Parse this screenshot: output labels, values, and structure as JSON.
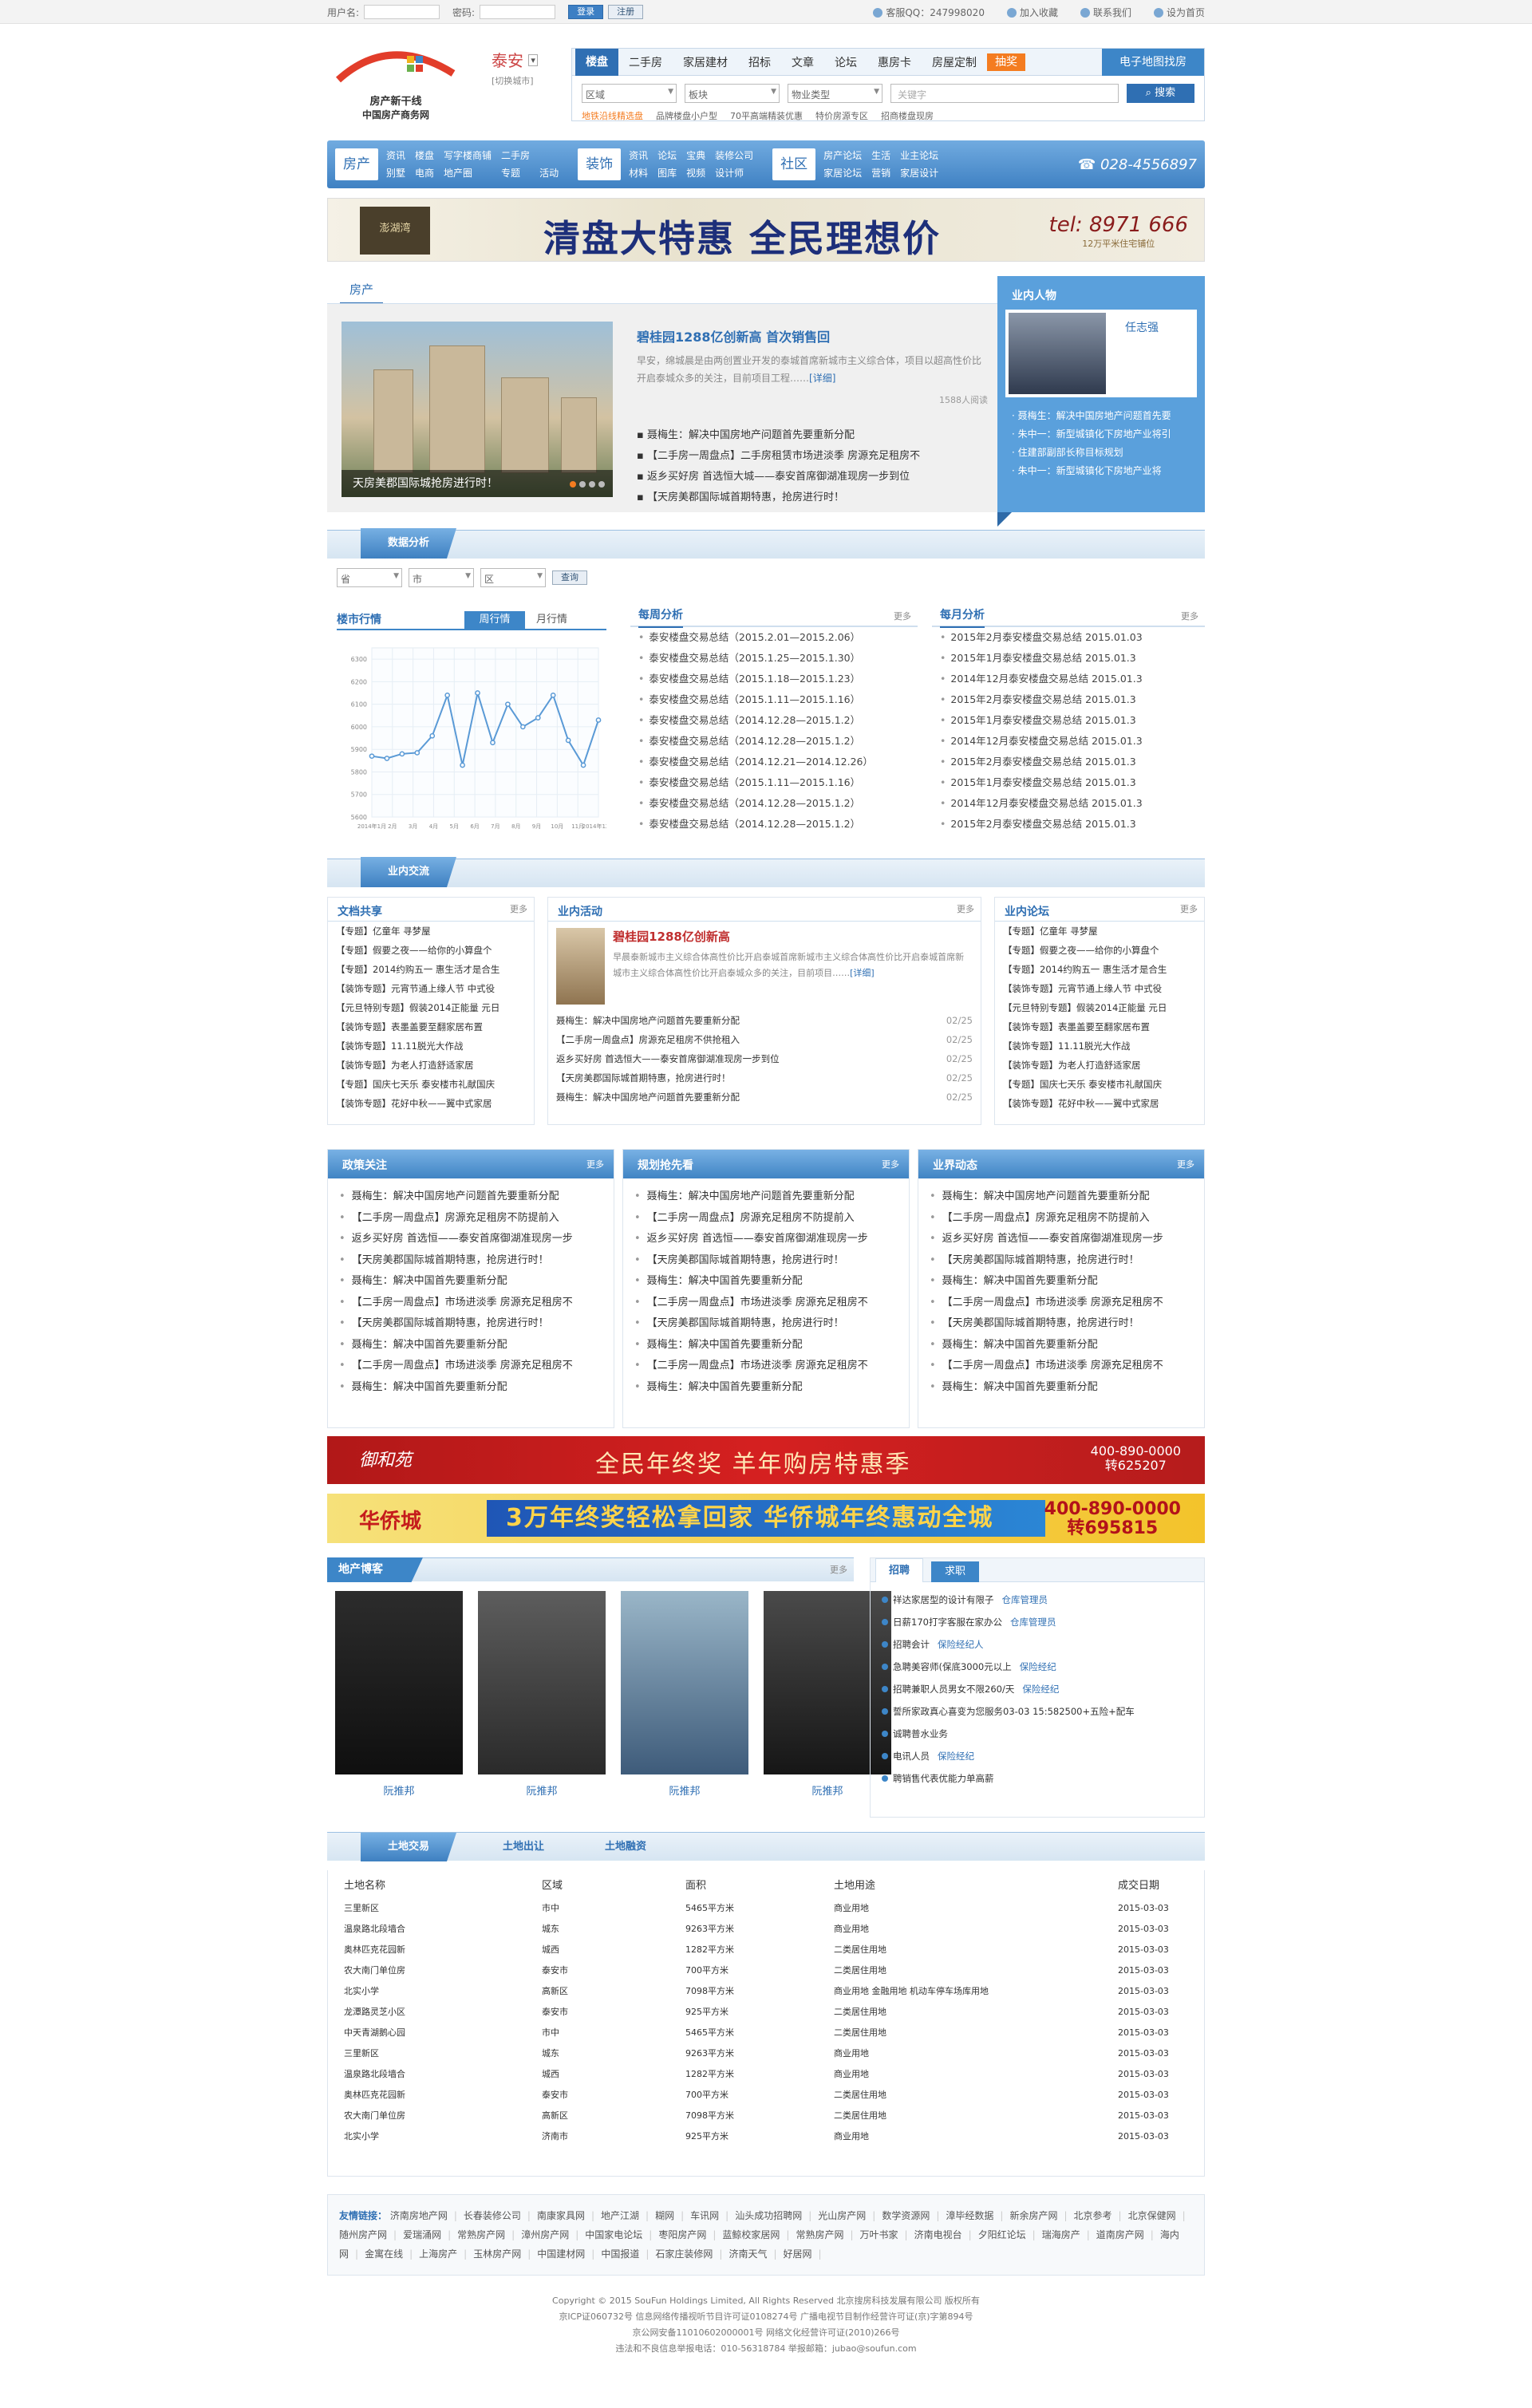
{
  "topbar": {
    "username_label": "用户名:",
    "password_label": "密码:",
    "login": "登录",
    "register": "注册",
    "qq": "客服QQ：247998020",
    "favorite": "加入收藏",
    "contact": "联系我们",
    "homepage": "设为首页"
  },
  "logo": {
    "line1": "房产新干线",
    "line2": "中国房产商务网"
  },
  "city": {
    "name": "泰安",
    "switch": "[切换城市]"
  },
  "nav": {
    "tabs": [
      "楼盘",
      "二手房",
      "家居建材",
      "招标",
      "文章",
      "论坛",
      "惠房卡",
      "房屋定制"
    ],
    "hot": "抽奖",
    "map": "电子地图找房",
    "filters": [
      "区域",
      "板块",
      "物业类型"
    ],
    "search_placeholder": "关键字",
    "search_button": "搜索",
    "hot_links": [
      "地铁沿线精选盘",
      "品牌楼盘小户型",
      "70平高端精装优惠",
      "特价房源专区",
      "招商楼盘现房"
    ]
  },
  "channels": [
    {
      "name": "房产",
      "links": [
        "资讯",
        "别墅",
        "楼盘",
        "电商",
        "写字楼商铺",
        "地产圈",
        "二手房",
        "专题",
        "",
        "活动"
      ]
    },
    {
      "name": "装饰",
      "links": [
        "资讯",
        "材料",
        "论坛",
        "图库",
        "宝典",
        "视频",
        "装修公司",
        "设计师"
      ]
    },
    {
      "name": "社区",
      "links": [
        "房产论坛",
        "家居论坛",
        "生活",
        "营销",
        "业主论坛",
        "家居设计"
      ]
    }
  ],
  "phone": "028-4556897",
  "banner1": {
    "logo": "澎湖湾",
    "text": "清盘大特惠  全民理想价",
    "tel": "tel: 8971 666",
    "sub": "12万平米住宅铺位"
  },
  "house": {
    "tab": "房产",
    "photo_caption": "天房美郡国际城抢房进行时！",
    "headline": "碧桂园1288亿创新高 首次销售回",
    "summary": "早安，绵城晨是由两创置业开发的泰城首席新城市主义综合体，项目以超高性价比开启泰城众多的关注，目前项目工程……",
    "detail": "[详细]",
    "reads": "1588人阅读",
    "news": [
      "聂梅生：解决中国房地产问题首先要重新分配",
      "【二手房一周盘点】二手房租赁市场进淡季 房源充足租房不",
      "返乡买好房 首选恒大城——泰安首席御湖准现房一步到位",
      "【天房美郡国际城首期特惠，抢房进行时！"
    ]
  },
  "person": {
    "title": "业内人物",
    "name": "任志强",
    "items": [
      "聂梅生：解决中国房地产问题首先要",
      "朱中一：新型城镇化下房地产业将引",
      "住建部副部长称目标规划",
      "朱中一：新型城镇化下房地产业将"
    ]
  },
  "data_section": {
    "title": "数据分析",
    "filters": [
      "省",
      "市",
      "区"
    ],
    "query": "查询",
    "market_title": "楼市行情",
    "tab_week": "周行情",
    "tab_month": "月行情",
    "weekly_title": "每周分析",
    "monthly_title": "每月分析",
    "more": "更多",
    "weekly": [
      "泰安楼盘交易总结（2015.2.01—2015.2.06）",
      "泰安楼盘交易总结（2015.1.25—2015.1.30）",
      "泰安楼盘交易总结（2015.1.18—2015.1.23）",
      "泰安楼盘交易总结（2015.1.11—2015.1.16）",
      "泰安楼盘交易总结（2014.12.28—2015.1.2）",
      "泰安楼盘交易总结（2014.12.28—2015.1.2）",
      "泰安楼盘交易总结（2014.12.21—2014.12.26）",
      "泰安楼盘交易总结（2015.1.11—2015.1.16）",
      "泰安楼盘交易总结（2014.12.28—2015.1.2）",
      "泰安楼盘交易总结（2014.12.28—2015.1.2）"
    ],
    "monthly": [
      "2015年2月泰安楼盘交易总结   2015.01.03",
      "2015年1月泰安楼盘交易总结   2015.01.3",
      "2014年12月泰安楼盘交易总结   2015.01.3",
      "2015年2月泰安楼盘交易总结   2015.01.3",
      "2015年1月泰安楼盘交易总结   2015.01.3",
      "2014年12月泰安楼盘交易总结   2015.01.3",
      "2015年2月泰安楼盘交易总结   2015.01.3",
      "2015年1月泰安楼盘交易总结   2015.01.3",
      "2014年12月泰安楼盘交易总结   2015.01.3",
      "2015年2月泰安楼盘交易总结   2015.01.3"
    ]
  },
  "chart_data": {
    "type": "line",
    "title": "楼市行情",
    "y_ticks": [
      "6300",
      "6200",
      "6100",
      "6000",
      "5900",
      "5800",
      "5700",
      "5600"
    ],
    "x_ticks": [
      "2014年1月",
      "2月",
      "3月",
      "4月",
      "5月",
      "6月",
      "7月",
      "8月",
      "9月",
      "10月",
      "11月",
      "2014年12月"
    ],
    "values": [
      5870,
      5860,
      5880,
      5885,
      5960,
      6140,
      5830,
      6150,
      5930,
      6100,
      6000,
      6040,
      6140,
      5940,
      5830,
      6030
    ],
    "ylim": [
      5600,
      6350
    ],
    "grid": true
  },
  "exchange": {
    "title": "业内交流",
    "docs_title": "文档共享",
    "activity_title": "业内活动",
    "forum_title": "业内论坛",
    "more": "更多",
    "docs": [
      "【专题】亿童年 寻梦屋",
      "【专题】假要之夜——给你的小算盘个",
      "【专题】2014约购五一 惠生活才是合生",
      "【装饰专题】元宵节通上缘人节 中式役",
      "【元旦特别专题】假装2014正能量  元日",
      "【装饰专题】表墨盖要至翻家居布置",
      "【装饰专题】11.11脱光大作战",
      "【装饰专题】为老人打造舒适家居",
      "【专题】国庆七天乐 泰安楼市礼献国庆",
      "【装饰专题】花好中秋——翼中式家居"
    ],
    "activity": {
      "headline": "碧桂园1288亿创新高",
      "summary": "早晨泰新城市主义综合体高性价比开启泰城首席新城市主义综合体高性价比开启泰城首席新城市主义综合体高性价比开启泰城众多的关注，目前项目……",
      "detail": "[详细]",
      "items": [
        {
          "t": "聂梅生：解决中国房地产问题首先要重新分配",
          "d": "02/25"
        },
        {
          "t": "【二手房一周盘点】房源充足租房不供抢租入",
          "d": "02/25"
        },
        {
          "t": "返乡买好房 首选恒大——泰安首席御湖准现房一步到位",
          "d": "02/25"
        },
        {
          "t": "【天房美郡国际城首期特惠，抢房进行时！",
          "d": "02/25"
        },
        {
          "t": "聂梅生：解决中国房地产问题首先要重新分配",
          "d": "02/25"
        }
      ]
    },
    "forum": [
      "【专题】亿童年 寻梦屋",
      "【专题】假要之夜——给你的小算盘个",
      "【专题】2014约购五一 惠生活才是合生",
      "【装饰专题】元宵节通上缘人节 中式役",
      "【元旦特别专题】假装2014正能量  元日",
      "【装饰专题】表墨盖要至翻家居布置",
      "【装饰专题】11.11脱光大作战",
      "【装饰专题】为老人打造舒适家居",
      "【专题】国庆七天乐 泰安楼市礼献国庆",
      "【装饰专题】花好中秋——翼中式家居"
    ]
  },
  "three_cols": [
    {
      "title": "政策关注",
      "more": "更多"
    },
    {
      "title": "规划抢先看",
      "more": "更多"
    },
    {
      "title": "业界动态",
      "more": "更多"
    }
  ],
  "three_items": [
    "聂梅生：解决中国房地产问题首先要重新分配",
    "【二手房一周盘点】房源充足租房不防提前入",
    "返乡买好房 首选恒——泰安首席御湖准现房一步",
    "【天房美郡国际城首期特惠，抢房进行时！",
    "聂梅生：解决中国首先要重新分配",
    "【二手房一周盘点】市场进淡季 房源充足租房不",
    "【天房美郡国际城首期特惠，抢房进行时！",
    "聂梅生：解决中国首先要重新分配",
    "【二手房一周盘点】市场进淡季 房源充足租房不",
    "聂梅生：解决中国首先要重新分配"
  ],
  "ad_red": {
    "logo": "御和苑",
    "text": "全民年终奖 羊年购房特惠季",
    "tel": "400-890-0000",
    "ext": "转625207"
  },
  "ad_yellow": {
    "logo": "华侨城",
    "text": "3万年终奖轻松拿回家  华侨城年终惠动全城",
    "tel": "400-890-0000",
    "ext": "转695815"
  },
  "blog": {
    "title": "地产博客",
    "more": "更多",
    "bloggers": [
      "阮推邦",
      "阮推邦",
      "阮推邦",
      "阮推邦"
    ]
  },
  "recruit": {
    "tab_on": "招聘",
    "tab_off": "求职",
    "items": [
      {
        "t": "祥达家居型的设计有限子",
        "c": "仓库管理员"
      },
      {
        "t": "日薪170打字客服在家办公",
        "c": "仓库管理员"
      },
      {
        "t": "招聘会计",
        "c": "保险经纪人"
      },
      {
        "t": "急聘美容师(保底3000元以上",
        "c": "保险经纪"
      },
      {
        "t": "招聘兼职人员男女不限260/天",
        "c": "保险经纪"
      },
      {
        "t": "誓所家政真心喜变为您服务03-03 15:582500+五险+配车",
        "c": ""
      },
      {
        "t": "诚聘普水业务",
        "c": ""
      },
      {
        "t": "电讯人员",
        "c": "保险经纪"
      },
      {
        "t": "聘销售代表优能力单高薪",
        "c": ""
      }
    ]
  },
  "land": {
    "tabs": [
      "土地交易",
      "土地出让",
      "土地融资"
    ],
    "headers": [
      "土地名称",
      "区域",
      "面积",
      "土地用途",
      "成交日期"
    ],
    "rows": [
      [
        "三里新区",
        "市中",
        "5465平方米",
        "商业用地",
        "2015-03-03"
      ],
      [
        "温泉路北段墙合",
        "城东",
        "9263平方米",
        "商业用地",
        "2015-03-03"
      ],
      [
        "奥林匹克花园新",
        "城西",
        "1282平方米",
        "二类居住用地",
        "2015-03-03"
      ],
      [
        "农大南门单位房",
        "泰安市",
        "700平方米",
        "二类居住用地",
        "2015-03-03"
      ],
      [
        "北实小学",
        "高新区",
        "7098平方米",
        "商业用地  金融用地  机动车停车场库用地",
        "2015-03-03"
      ],
      [
        "龙潭路灵芝小区",
        "泰安市",
        "925平方米",
        "二类居住用地",
        "2015-03-03"
      ],
      [
        "中天青湖鹅心园",
        "市中",
        "5465平方米",
        "二类居住用地",
        "2015-03-03"
      ],
      [
        "三里新区",
        "城东",
        "9263平方米",
        "商业用地",
        "2015-03-03"
      ],
      [
        "温泉路北段墙合",
        "城西",
        "1282平方米",
        "商业用地",
        "2015-03-03"
      ],
      [
        "奥林匹克花园新",
        "泰安市",
        "700平方米",
        "二类居住用地",
        "2015-03-03"
      ],
      [
        "农大南门单位房",
        "高新区",
        "7098平方米",
        "二类居住用地",
        "2015-03-03"
      ],
      [
        "北实小学",
        "济南市",
        "925平方米",
        "商业用地",
        "2015-03-03"
      ]
    ]
  },
  "friends": {
    "label": "友情链接：",
    "links": [
      "济南房地产网",
      "长春装修公司",
      "南康家具网",
      "地产江湖",
      "糊网",
      "车讯网",
      "汕头成功招聘网",
      "光山房产网",
      "数学资源网",
      "漳毕经数据",
      "新余房产网",
      "北京参考",
      "北京保健网",
      "随州房产网",
      "爱瑞涌网",
      "常熟房产网",
      "漳州房产网",
      "中国家电论坛",
      "枣阳房产网",
      "蓝鲸校家居网",
      "常熟房产网",
      "万叶书家",
      "济南电视台",
      "夕阳红论坛",
      "瑞海房产",
      "道南房产网",
      "海内网",
      "金寓在线",
      "上海房产",
      "玉林房产网",
      "中国建材网",
      "中国报道",
      "石家庄装修网",
      "济南天气",
      "好居网"
    ]
  },
  "footer": {
    "copyright": "Copyright © 2015 SouFun Holdings Limited, All Rights Reserved 北京搜房科技发展有限公司 版权所有",
    "icp": "京ICP证060732号  信息网络传播视听节目许可证0108274号  广播电视节目制作经营许可证(京)字第894号",
    "police": "京公网安备11010602000001号  网络文化经营许可证(2010)266号",
    "report": "违法和不良信息举报电话：010-56318784  举报邮箱：jubao@soufun.com"
  }
}
